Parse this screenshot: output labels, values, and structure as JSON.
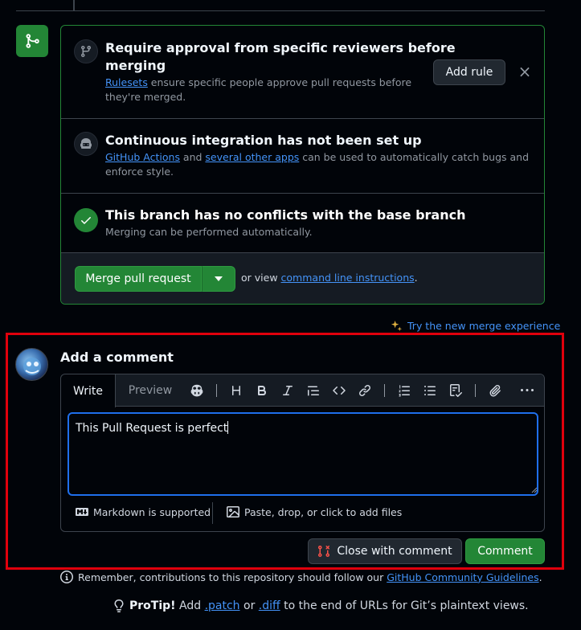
{
  "merge_section": {
    "reviewers": {
      "title_line1": "Require approval from specific reviewers before",
      "title_line2": "merging",
      "link": "Rulesets",
      "desc_line1_rest": " ensure specific people approve pull requests before",
      "desc_line2": "they're merged.",
      "add_rule_label": "Add rule",
      "close_label": "×"
    },
    "ci": {
      "title": "Continuous integration has not been set up",
      "link1": "GitHub Actions",
      "and_text": " and ",
      "link2": "several other apps",
      "desc_rest": " can be used to automatically catch bugs and",
      "desc_line2": "enforce style."
    },
    "conflicts": {
      "title": "This branch has no conflicts with the base branch",
      "desc": "Merging can be performed automatically."
    },
    "merge": {
      "button_label": "Merge pull request",
      "or_view": "or view ",
      "cli_link": "command line instructions",
      "period": "."
    }
  },
  "try_new": "Try the new merge experience",
  "comment": {
    "heading": "Add a comment",
    "tabs": {
      "write": "Write",
      "preview": "Preview"
    },
    "toolbar_icons": [
      "copilot-icon",
      "heading-icon",
      "bold-icon",
      "italic-icon",
      "quote-icon",
      "code-icon",
      "link-icon",
      "ordered-list-icon",
      "unordered-list-icon",
      "task-list-icon",
      "attach-icon",
      "more-icon"
    ],
    "text_value": "This Pull Request is perfect",
    "markdown_supported": "Markdown is supported",
    "attach_files": "Paste, drop, or click to add files",
    "close_with_comment": "Close with comment",
    "comment_button": "Comment"
  },
  "notice": {
    "text": "Remember, contributions to this repository should follow our ",
    "link": "GitHub Community Guidelines",
    "end": "."
  },
  "protip": {
    "label": "ProTip!",
    "text1": " Add ",
    "patch": ".patch",
    "or": " or ",
    "diff": ".diff",
    "text2": " to the end of URLs for Git’s plaintext views."
  },
  "colors": {
    "accent_green": "#238636",
    "link_blue": "#4493f8",
    "highlight_red": "#e0000c"
  }
}
